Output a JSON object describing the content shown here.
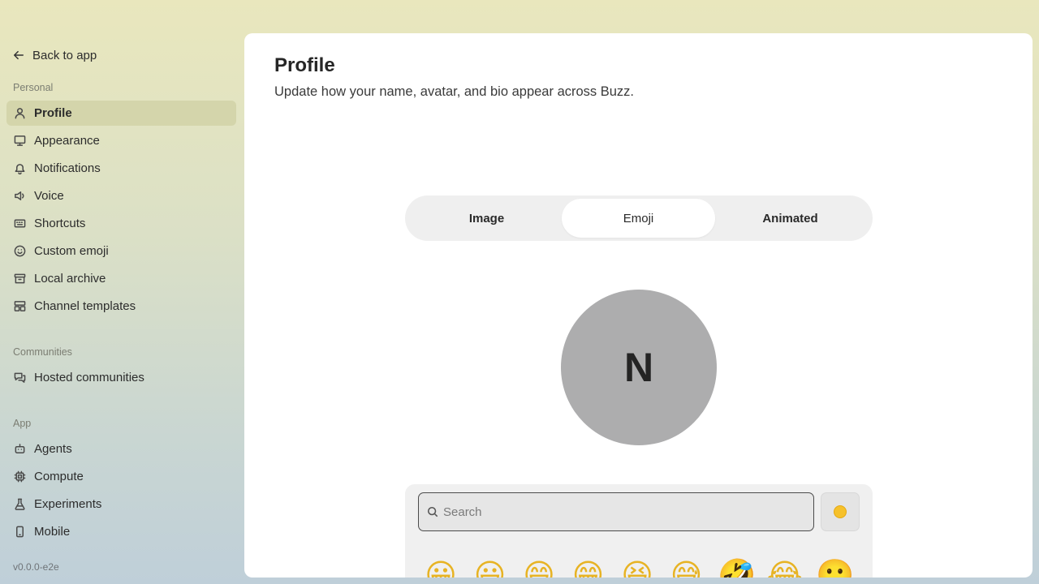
{
  "sidebar": {
    "back_label": "Back to app",
    "sections": [
      {
        "label": "Personal"
      },
      {
        "label": "Communities"
      },
      {
        "label": "App"
      }
    ],
    "items": [
      {
        "label": "Profile",
        "icon": "user-icon",
        "active": true
      },
      {
        "label": "Appearance",
        "icon": "monitor-icon"
      },
      {
        "label": "Notifications",
        "icon": "bell-icon"
      },
      {
        "label": "Voice",
        "icon": "speaker-icon"
      },
      {
        "label": "Shortcuts",
        "icon": "keyboard-icon"
      },
      {
        "label": "Custom emoji",
        "icon": "smile-icon"
      },
      {
        "label": "Local archive",
        "icon": "archive-icon"
      },
      {
        "label": "Channel templates",
        "icon": "layout-icon"
      },
      {
        "label": "Hosted communities",
        "icon": "messages-icon"
      },
      {
        "label": "Agents",
        "icon": "bot-icon"
      },
      {
        "label": "Compute",
        "icon": "cpu-icon"
      },
      {
        "label": "Experiments",
        "icon": "flask-icon"
      },
      {
        "label": "Mobile",
        "icon": "phone-icon"
      }
    ],
    "version": "v0.0.0-e2e"
  },
  "main": {
    "title": "Profile",
    "subtitle": "Update how your name, avatar, and bio appear across Buzz.",
    "tabs": [
      {
        "label": "Image"
      },
      {
        "label": "Emoji",
        "active": true
      },
      {
        "label": "Animated"
      }
    ],
    "avatar_initial": "N",
    "picker": {
      "search_placeholder": "Search",
      "skin_tone_color": "#f6c12b",
      "emojis": [
        "😀",
        "😃",
        "😄",
        "😁",
        "😆",
        "😅",
        "🤣",
        "😂",
        "🙂"
      ]
    }
  },
  "colors": {
    "active_nav_bg": "#d4d5ab",
    "avatar_bg": "#adadae"
  }
}
